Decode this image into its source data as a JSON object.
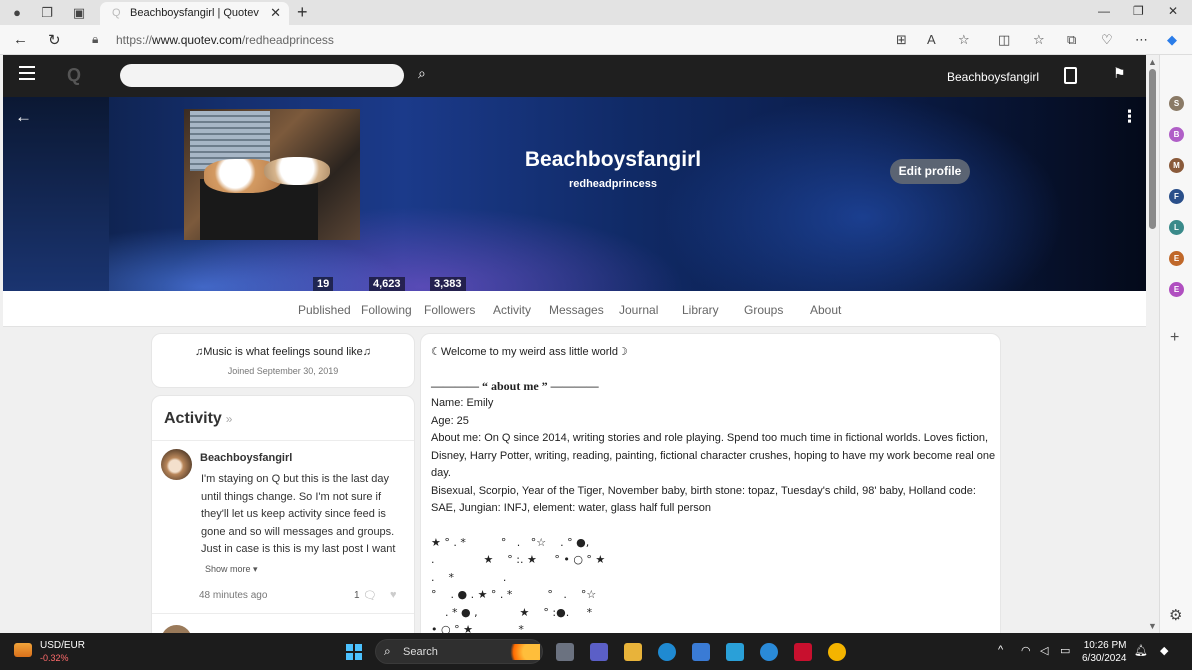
{
  "browser": {
    "tab_title": "Beachboysfangirl | Quotev",
    "url_prefix": "https://",
    "url_host": "www.quotev.com",
    "url_path": "/redheadprincess"
  },
  "site": {
    "logo": "Q",
    "username": "Beachboysfangirl"
  },
  "profile": {
    "display_name": "Beachboysfangirl",
    "username": "redheadprincess",
    "edit_label": "Edit profile",
    "stats": [
      "19",
      "4,623",
      "3,383"
    ]
  },
  "nav": {
    "tabs": [
      "Published",
      "Following",
      "Followers",
      "Activity",
      "Messages",
      "Journal",
      "Library",
      "Groups",
      "About"
    ]
  },
  "bio": {
    "quote": "♫Music is what feelings sound like♫",
    "joined": "Joined September 30, 2019"
  },
  "activity": {
    "heading": "Activity",
    "heading_arrow": "»",
    "poster": "Beachboysfangirl",
    "post": "I'm staying on Q but this is the last day until things change. So I'm not sure if they'll let us keep activity since feed is gone and so will messages and groups. Just in case is this is my last post I want",
    "show_more": "Show more ▾",
    "time": "48 minutes ago",
    "comments": "1"
  },
  "about": {
    "welcome": "☾Welcome to my weird ass little world☽",
    "heading": "———— “ about me ” ————",
    "name": "Name: Emily",
    "age": "Age: 25",
    "about": "About me: On Q since 2014, writing stories and role playing. Spend too much time in fictional worlds. Loves fiction, Disney, Harry Potter, writing, reading, painting, fictional character crushes, hoping to have my work become real one day.",
    "traits": "Bisexual, Scorpio, Year of the Tiger, November baby, birth stone: topaz, Tuesday's child, 98' baby, Holland code: SAE, Jungian: INFJ, element: water, glass half full person",
    "stars": [
      "★ ° . *          °   .   °☆    . ° ●,",
      ".              ★    ° :. ★     ° • ○ ° ★",
      ".    *              .",
      "°    . ● . ★ ° . *          °   .    °☆",
      "    . * ● ,            ★    ° :●.     *",
      "• ○ ° ★             *"
    ]
  },
  "sidebar": {
    "avatars": [
      {
        "letter": "S",
        "color": "#8a7a66"
      },
      {
        "letter": "B",
        "color": "#b05fc7"
      },
      {
        "letter": "M",
        "color": "#8a5a3a"
      },
      {
        "letter": "F",
        "color": "#2a4f8a"
      },
      {
        "letter": "L",
        "color": "#3a8a8a"
      },
      {
        "letter": "E",
        "color": "#c0682a"
      },
      {
        "letter": "E",
        "color": "#b04fc0"
      }
    ]
  },
  "taskbar": {
    "ticker": "USD/EUR",
    "change": "-0.32%",
    "search": "Search",
    "time": "10:26 PM",
    "date": "6/30/2024"
  }
}
